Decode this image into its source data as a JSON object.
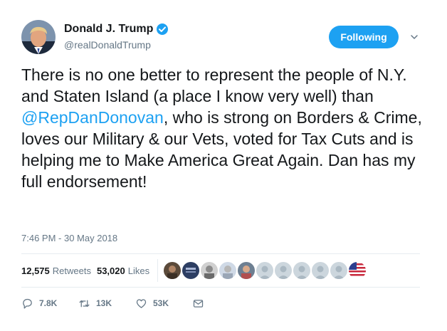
{
  "user": {
    "display_name": "Donald J. Trump",
    "handle": "@realDonaldTrump",
    "avatar_icon": "profile-avatar",
    "verified_icon": "verified-badge-icon"
  },
  "follow_button": {
    "label": "Following"
  },
  "tweet": {
    "text_before": "There is no one better to represent the people of N.Y. and Staten Island (a place I know very well) than ",
    "mention": "@RepDanDonovan",
    "text_after": ", who is strong on Borders & Crime, loves our Military & our Vets, voted for Tax Cuts and is helping me to Make America Great Again. Dan has my full endorsement!",
    "timestamp": "7:46 PM - 30 May 2018"
  },
  "stats": {
    "retweets_count": "12,575",
    "retweets_label": "Retweets",
    "likes_count": "53,020",
    "likes_label": "Likes"
  },
  "actions": {
    "reply_count": "7.8K",
    "retweet_count": "13K",
    "like_count": "53K"
  },
  "colors": {
    "accent": "#1da1f2",
    "text": "#14171a",
    "secondary": "#657786",
    "divider": "#e6ecf0"
  }
}
